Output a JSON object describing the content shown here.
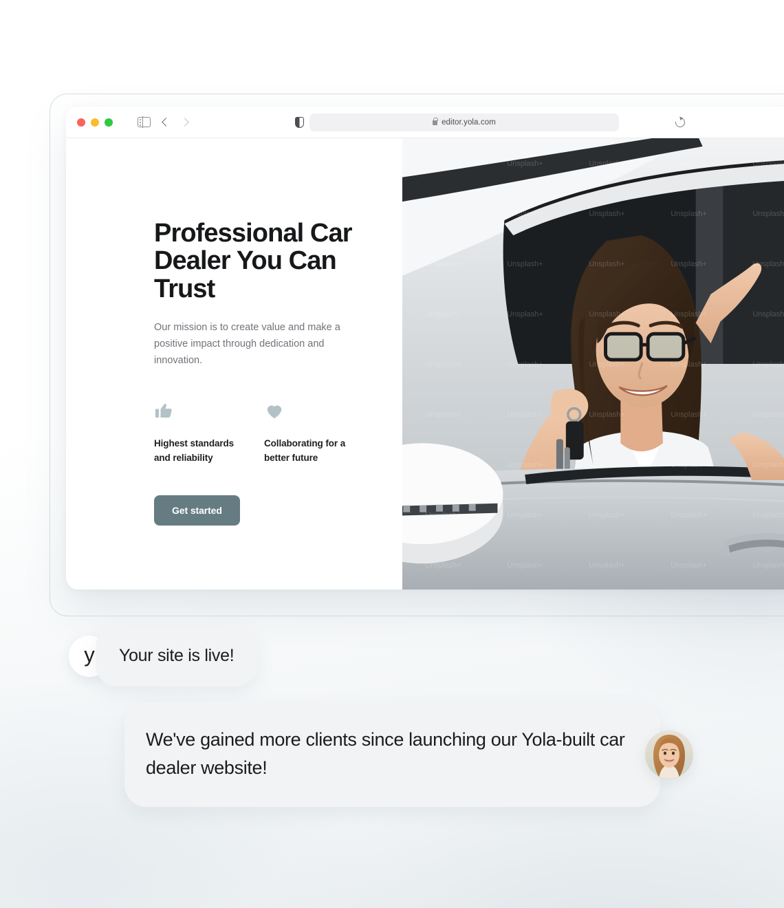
{
  "browser": {
    "url": "editor.yola.com",
    "icons": {
      "lock": "lock-icon",
      "reload": "reload-icon",
      "sidebar": "sidebar-toggle-icon",
      "back": "back-chevron-icon",
      "forward": "forward-chevron-icon",
      "shield": "privacy-shield-icon"
    },
    "traffic_lights": [
      "close",
      "minimize",
      "zoom"
    ]
  },
  "site": {
    "hero": {
      "title": "Professional Car Dealer You Can Trust",
      "subtitle": "Our mission is to create value and make a positive impact through dedication and innovation.",
      "cta_label": "Get started"
    },
    "features": [
      {
        "icon": "thumbs-up-icon",
        "label": "Highest standards and reliability"
      },
      {
        "icon": "heart-icon",
        "label": "Collaborating for a better future"
      }
    ],
    "photo": {
      "alt": "Smiling woman with glasses holding car keys out of a white car window",
      "watermark": "Unsplash+"
    }
  },
  "chat": {
    "logo_letter": "y",
    "messages": [
      {
        "text": "Your site is live!"
      },
      {
        "text": "We've gained more clients since launching our Yola-built car dealer website!"
      }
    ],
    "avatar_alt": "Portrait of a smiling woman with light brown hair"
  },
  "colors": {
    "cta": "#667c83",
    "feature_icon": "#b2c2c6",
    "bubble": "#f2f3f4",
    "text_primary": "#1b1c1f",
    "text_muted": "#6f7378"
  }
}
